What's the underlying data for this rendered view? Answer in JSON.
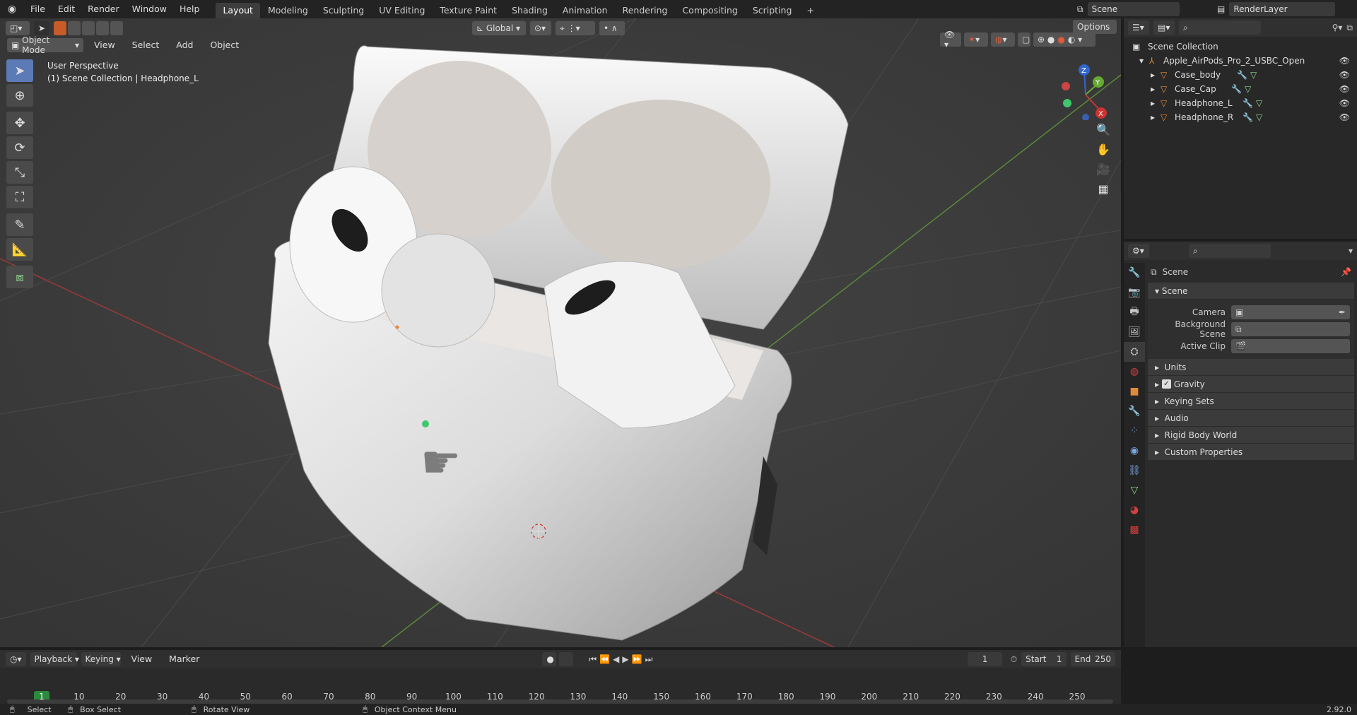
{
  "topbar": {
    "menus": [
      "File",
      "Edit",
      "Render",
      "Window",
      "Help"
    ],
    "tabs": [
      "Layout",
      "Modeling",
      "Sculpting",
      "UV Editing",
      "Texture Paint",
      "Shading",
      "Animation",
      "Rendering",
      "Compositing",
      "Scripting"
    ],
    "add_tab": "+",
    "scene": "Scene",
    "render_layer": "RenderLayer"
  },
  "viewport": {
    "mode": "Object Mode",
    "menus": [
      "View",
      "Select",
      "Add",
      "Object"
    ],
    "orientation": "Global",
    "options": "Options",
    "info_line1": "User Perspective",
    "info_line2": "(1) Scene Collection | Headphone_L",
    "gizmo_axes": [
      "X",
      "Y",
      "Z"
    ]
  },
  "outliner": {
    "root": "Scene Collection",
    "collection": "Apple_AirPods_Pro_2_USBC_Open",
    "items": [
      "Case_body",
      "Case_Cap",
      "Headphone_L",
      "Headphone_R"
    ]
  },
  "properties": {
    "header": "Scene",
    "panel": "Scene",
    "fields": [
      {
        "label": "Camera",
        "value": ""
      },
      {
        "label": "Background Scene",
        "value": ""
      },
      {
        "label": "Active Clip",
        "value": ""
      }
    ],
    "subpanels": [
      {
        "label": "Units",
        "checkbox": false
      },
      {
        "label": "Gravity",
        "checkbox": true
      },
      {
        "label": "Keying Sets",
        "checkbox": false
      },
      {
        "label": "Audio",
        "checkbox": false
      },
      {
        "label": "Rigid Body World",
        "checkbox": false
      },
      {
        "label": "Custom Properties",
        "checkbox": false
      }
    ]
  },
  "timeline": {
    "menus": [
      "Playback",
      "Keying",
      "View",
      "Marker"
    ],
    "current_frame": "1",
    "start_label": "Start",
    "start": "1",
    "end_label": "End",
    "end": "250",
    "frame_marker": "1",
    "ticks": [
      "10",
      "20",
      "30",
      "40",
      "50",
      "60",
      "70",
      "80",
      "90",
      "100",
      "110",
      "120",
      "130",
      "140",
      "150",
      "160",
      "170",
      "180",
      "190",
      "200",
      "210",
      "220",
      "230",
      "240",
      "250"
    ]
  },
  "statusbar": {
    "select": "Select",
    "box_select": "Box Select",
    "rotate_view": "Rotate View",
    "context_menu": "Object Context Menu",
    "version": "2.92.0"
  },
  "colors": {
    "accent": "#5c7ab6",
    "frame_marker": "#2a8a3c",
    "x_axis": "#9b3a3a",
    "y_axis": "#5a8a3a",
    "object_orange": "#e08a3a"
  }
}
